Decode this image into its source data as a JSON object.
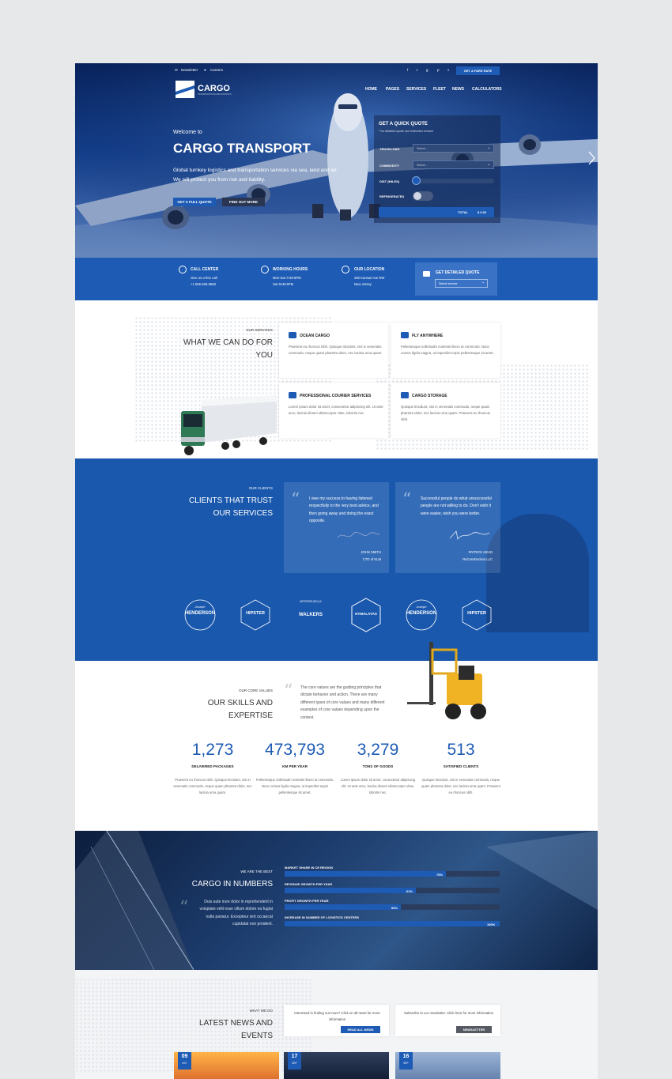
{
  "topbar": {
    "newsletter": "Newsletter",
    "careers": "Careers",
    "cta": "GET A FARE RATE"
  },
  "logo": {
    "name": "CARGO",
    "tagline": "TRANSPORTATION AND LOGISTICS"
  },
  "nav": [
    "HOME",
    "PAGES",
    "SERVICES",
    "FLEET",
    "NEWS",
    "CALCULATORS"
  ],
  "hero": {
    "welcome": "Welcome to",
    "title": "CARGO TRANSPORT",
    "description": "Global turnkey logistics and transportation services via sea, land and air. We will protect you from risk and liability.",
    "btn_primary": "GET A FULL QUOTE",
    "btn_secondary": "FIND OUT MORE"
  },
  "quote": {
    "title": "GET A QUICK QUOTE",
    "subtitle": "* for detailed quote use extended version",
    "truckload_label": "TRUCKLOAD",
    "truckload_value": "Select...",
    "commodity_label": "COMMODITY",
    "commodity_value": "Select...",
    "distance_label": "DIST (MILES)",
    "refrigerated_label": "REFRIGERATED",
    "total_label": "TOTAL",
    "total_value": "$ 0.00"
  },
  "info": {
    "call_title": "CALL CENTER",
    "call_l1": "Give us a free call",
    "call_l2": "+1 555-626-5550",
    "hours_title": "WORKING HOURS",
    "hours_l1": "Mon-Sat 7AM-5PM",
    "hours_l2": "Sat 9AM-5PM",
    "loc_title": "OUR LOCATION",
    "loc_l1": "300 Kansas Ave NW",
    "loc_l2": "New Jersey",
    "detailed_title": "GET DETAILED QUOTE",
    "detailed_select": "Select service"
  },
  "services": {
    "kicker": "OUR SERVICES",
    "title_l1": "WHAT WE CAN DO FOR",
    "title_l2": "YOU",
    "items": [
      {
        "title": "OCEAN CARGO",
        "text": "Praesent eu rhoncus nibh. Quisque tincidunt, nisi in venenatis commodo, neque quam pharetra dolor, nec lacinia urna quam."
      },
      {
        "title": "FLY ANYWHERE",
        "text": "Pellentesque sollicitudin molestie libero at commodo. Nunc cursus ligula magna, ut imperdiet turpis pellentesque sit amet."
      },
      {
        "title": "PROFESSIONAL COURIER SERVICES",
        "text": "Lorem ipsum dolor sit amet, consectetur adipiscing elit. Ut ante arcu, lacinia dictum ullamcorper vitae, lobortis nec."
      },
      {
        "title": "CARGO STORAGE",
        "text": "Quisque tincidunt, nisi in venenatis commodo, neque quam pharetra dolor, nec lacinia urna quam. Praesent eu rhoncus nibh."
      }
    ]
  },
  "clients": {
    "kicker": "OUR CLIENTS",
    "title_l1": "CLIENTS THAT TRUST",
    "title_l2": "OUR SERVICES",
    "testimonials": [
      {
        "text": "I owe my success to having listened respectfully to the very best advice, and then going away and doing the exact opposite.",
        "name": "JOHN SMITH",
        "role": "CTO of KLM"
      },
      {
        "text": "Successful people do what unsuccessful people are not willing to do. Don't wish it were easier, wish you were better.",
        "name": "PATRICK HEAD",
        "role": "ReConstruction LLC"
      }
    ],
    "logos": [
      {
        "small": "Joseph",
        "big": "HENDERSON"
      },
      {
        "small": "",
        "big": "HIPSTER"
      },
      {
        "small": "HIPSTERS-DELUX",
        "big": "WALKERS"
      },
      {
        "small": "",
        "big": "HYMALAYAS"
      },
      {
        "small": "Joseph",
        "big": "HENDERSON"
      },
      {
        "small": "",
        "big": "HIPSTER"
      }
    ]
  },
  "skills": {
    "kicker": "OUR CORE VALUES",
    "title_l1": "OUR SKILLS AND",
    "title_l2": "EXPERTISE",
    "quote": "The core values are the guiding principles that dictate behavior and action. There are many different types of core values and many different examples of core values depending upon the context.",
    "stats": [
      {
        "value": "1,273",
        "label": "DELIVERED PACKAGES",
        "text": "Praesent eu rhoncus nibh. Quisque tincidunt, nisi in venenatis commodo, neque quam pharetra dolor, nec lacinia urna quam."
      },
      {
        "value": "473,793",
        "label": "KM PER YEAR",
        "text": "Pellentesque sollicitudin molestie libero at commodo. Nunc cursus ligula magna, ut imperdiet turpis pellentesque sit amet."
      },
      {
        "value": "3,279",
        "label": "TONS OF GOODS",
        "text": "Lorem ipsum dolor sit amet, consectetur adipiscing elit. Ut ante arcu, lacinia dictum ullamcorper vitae, lobortis nec."
      },
      {
        "value": "513",
        "label": "SATISFIED CLIENTS",
        "text": "Quisque tincidunt, nisi in venenatis commodo, neque quam pharetra dolor, nec lacinia urna quam. Praesent eu rhoncus nibh."
      }
    ]
  },
  "numbers": {
    "kicker": "WE ARE THE BEST",
    "title": "CARGO IN NUMBERS",
    "quote": "Duis aute irure dolor in reprehenderit in voluptate velit esse cillum dolore eu fugiat nulla pariatur. Excepteur sint occaecat cupidatat non proident.",
    "bars": [
      {
        "label": "MARKET SHARE IN CE REGION",
        "value": 75,
        "display": "75%"
      },
      {
        "label": "REVENUE GROWTH PER YEAR",
        "value": 61,
        "display": "61%"
      },
      {
        "label": "PROFIT GROWTH PER YEAR",
        "value": 54,
        "display": "54%"
      },
      {
        "label": "INCREASE IN NUMBER OF LOGISTICS CENTERS",
        "value": 100,
        "display": "100%"
      }
    ]
  },
  "news": {
    "kicker": "WHAT WE DO",
    "title_l1": "LATEST NEWS AND",
    "title_l2": "EVENTS",
    "card1_text": "Interested in finding out more? Click on all news for more information",
    "card1_btn": "READ ALL NEWS",
    "card2_text": "Subscribe to our newsletter. Click here for more information",
    "card2_btn": "NEWSLETTER",
    "dates": [
      {
        "day": "09",
        "month": "OCT"
      },
      {
        "day": "17",
        "month": "SEP"
      },
      {
        "day": "16",
        "month": "SEP"
      }
    ]
  },
  "colors": {
    "primary": "#1e5bb4",
    "dark_navy": "#0d1e3d",
    "background": "#e7e8ea"
  }
}
